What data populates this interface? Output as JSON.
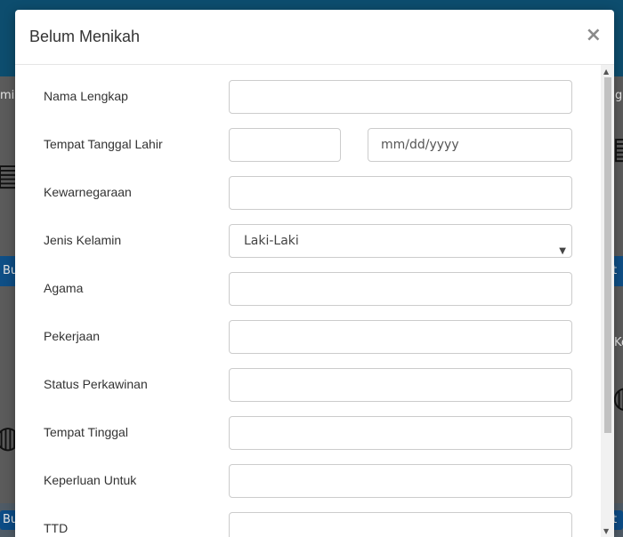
{
  "modal": {
    "title": "Belum Menikah",
    "close_label": "×"
  },
  "fields": [
    {
      "label": "Nama Lengkap",
      "value": ""
    },
    {
      "label": "Tempat Tanggal Lahir",
      "value": "",
      "date_placeholder": "mm/dd/yyyy"
    },
    {
      "label": "Kewarnegaraan",
      "value": ""
    },
    {
      "label": "Jenis Kelamin",
      "value": "Laki-Laki"
    },
    {
      "label": "Agama",
      "value": ""
    },
    {
      "label": "Pekerjaan",
      "value": ""
    },
    {
      "label": "Status Perkawinan",
      "value": ""
    },
    {
      "label": "Tempat Tinggal",
      "value": ""
    },
    {
      "label": "Keperluan Untuk",
      "value": ""
    },
    {
      "label": "TTD",
      "value": ""
    }
  ],
  "background": {
    "left_tab_fragment": "mis",
    "right_tab_fragment": "g",
    "left_button_fragment": "Bu",
    "right_button_fragment": "t",
    "right_button_fragment_2": "Ke",
    "bottom_left_fragment": "Bu",
    "bottom_right_fragment": "t"
  }
}
